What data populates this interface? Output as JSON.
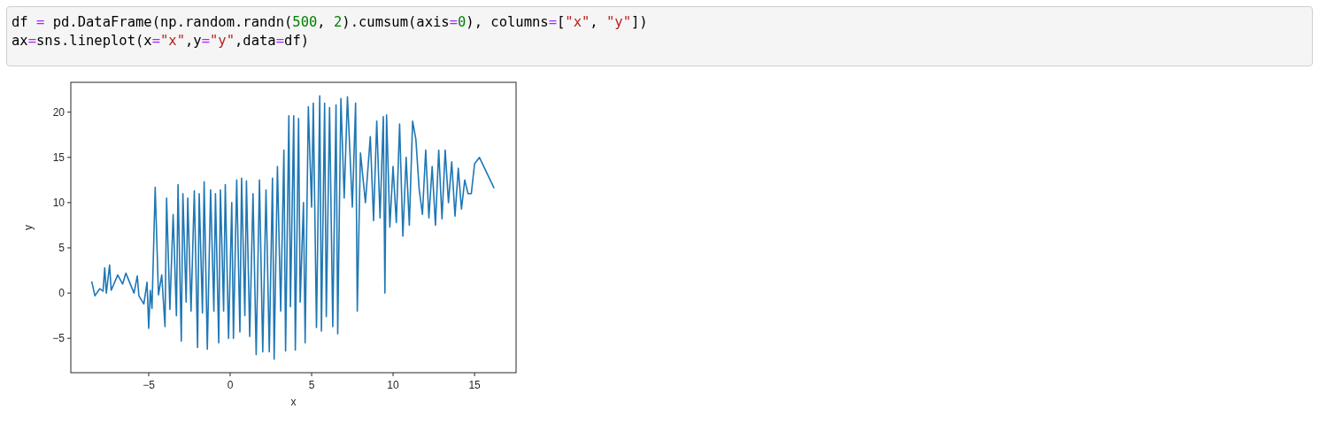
{
  "code_cell": {
    "lines": [
      [
        {
          "kind": "text",
          "text": "df "
        },
        {
          "kind": "op",
          "text": "="
        },
        {
          "kind": "text",
          "text": " pd.DataFrame(np.random.randn("
        },
        {
          "kind": "num",
          "text": "500"
        },
        {
          "kind": "text",
          "text": ", "
        },
        {
          "kind": "num",
          "text": "2"
        },
        {
          "kind": "text",
          "text": ").cumsum(axis"
        },
        {
          "kind": "op",
          "text": "="
        },
        {
          "kind": "num",
          "text": "0"
        },
        {
          "kind": "text",
          "text": "), columns"
        },
        {
          "kind": "op",
          "text": "="
        },
        {
          "kind": "text",
          "text": "["
        },
        {
          "kind": "str",
          "text": "\"x\""
        },
        {
          "kind": "text",
          "text": ", "
        },
        {
          "kind": "str",
          "text": "\"y\""
        },
        {
          "kind": "text",
          "text": "])"
        }
      ],
      [
        {
          "kind": "text",
          "text": "ax"
        },
        {
          "kind": "op",
          "text": "="
        },
        {
          "kind": "text",
          "text": "sns.lineplot(x"
        },
        {
          "kind": "op",
          "text": "="
        },
        {
          "kind": "str",
          "text": "\"x\""
        },
        {
          "kind": "text",
          "text": ",y"
        },
        {
          "kind": "op",
          "text": "="
        },
        {
          "kind": "str",
          "text": "\"y\""
        },
        {
          "kind": "text",
          "text": ",data"
        },
        {
          "kind": "op",
          "text": "="
        },
        {
          "kind": "text",
          "text": "df)"
        }
      ]
    ]
  },
  "output": {
    "chart_data": {
      "type": "line",
      "xlabel": "x",
      "ylabel": "y",
      "xlim": [
        -9.78,
        17.55
      ],
      "ylim": [
        -8.8,
        23.3
      ],
      "xticks": [
        {
          "value": -5,
          "label": "−5"
        },
        0,
        5,
        10,
        15
      ],
      "yticks": [
        {
          "value": -5,
          "label": "−5"
        },
        0,
        5,
        10,
        15,
        20
      ],
      "x": [
        -8.5,
        -8.3,
        -8.0,
        -7.8,
        -7.7,
        -7.6,
        -7.4,
        -7.3,
        -6.9,
        -6.6,
        -6.4,
        -5.9,
        -5.7,
        -5.6,
        -5.3,
        -5.1,
        -5.0,
        -4.9,
        -4.8,
        -4.6,
        -4.4,
        -4.2,
        -4.0,
        -3.9,
        -3.7,
        -3.5,
        -3.3,
        -3.2,
        -3.0,
        -2.9,
        -2.7,
        -2.6,
        -2.4,
        -2.2,
        -2.0,
        -1.9,
        -1.7,
        -1.6,
        -1.4,
        -1.2,
        -1.0,
        -0.9,
        -0.7,
        -0.6,
        -0.4,
        -0.3,
        -0.1,
        0.1,
        0.2,
        0.4,
        0.6,
        0.7,
        0.9,
        1.0,
        1.2,
        1.4,
        1.6,
        1.8,
        2.0,
        2.2,
        2.4,
        2.6,
        2.7,
        2.9,
        3.1,
        3.3,
        3.4,
        3.6,
        3.7,
        3.9,
        4.0,
        4.2,
        4.3,
        4.5,
        4.6,
        4.8,
        5.0,
        5.1,
        5.3,
        5.5,
        5.6,
        5.8,
        5.9,
        6.1,
        6.3,
        6.5,
        6.6,
        6.8,
        7.0,
        7.2,
        7.5,
        7.7,
        7.8,
        8.0,
        8.3,
        8.6,
        8.8,
        9.0,
        9.2,
        9.4,
        9.5,
        9.6,
        9.8,
        10.0,
        10.2,
        10.4,
        10.6,
        10.8,
        11.0,
        11.2,
        11.4,
        11.6,
        11.8,
        12.0,
        12.2,
        12.4,
        12.6,
        12.8,
        13.0,
        13.2,
        13.4,
        13.6,
        13.8,
        14.0,
        14.2,
        14.4,
        14.6,
        14.8,
        15.0,
        15.3,
        16.2
      ],
      "series": [
        {
          "color": "#1f77b4",
          "values": [
            1.3,
            -0.3,
            0.5,
            0.2,
            2.8,
            0,
            3.1,
            0.3,
            2,
            1,
            2.2,
            0,
            1.9,
            -0.3,
            -1.2,
            1.2,
            -3.9,
            0.3,
            -1.7,
            11.7,
            -0.2,
            2,
            -3.7,
            10.5,
            -1.8,
            8.7,
            -2.5,
            12,
            -5.3,
            11,
            -1,
            10.5,
            -2,
            11.3,
            -6,
            11,
            -2.2,
            12.3,
            -6.2,
            11.4,
            -2,
            11,
            -5.5,
            11.4,
            -2,
            12,
            -5,
            10,
            -5,
            12.5,
            -4.3,
            12.7,
            -2.5,
            12.4,
            -4.8,
            11,
            -6.8,
            12.5,
            -6.5,
            11.4,
            -6.5,
            12.7,
            -7.3,
            14,
            -2,
            15.8,
            -6.4,
            19.6,
            -1.5,
            19.6,
            -6.3,
            19.3,
            -1,
            10,
            -5.5,
            20.6,
            9.5,
            21,
            -3.8,
            21.8,
            -4.2,
            21,
            -2.6,
            20.5,
            -3.7,
            20.8,
            -4.5,
            21.5,
            10.5,
            21.7,
            9.5,
            21,
            -2,
            15.5,
            10,
            17.3,
            8,
            19,
            8.3,
            19.5,
            0,
            19.7,
            7.3,
            14,
            7.8,
            18.7,
            6.3,
            15,
            7.5,
            19,
            17,
            11.5,
            8.7,
            15.8,
            8.3,
            14,
            7.5,
            15.8,
            8.2,
            15.8,
            10,
            14.5,
            8.5,
            13.8,
            9.3,
            12.5,
            11,
            11,
            14.3,
            15,
            11.6
          ]
        }
      ]
    }
  }
}
